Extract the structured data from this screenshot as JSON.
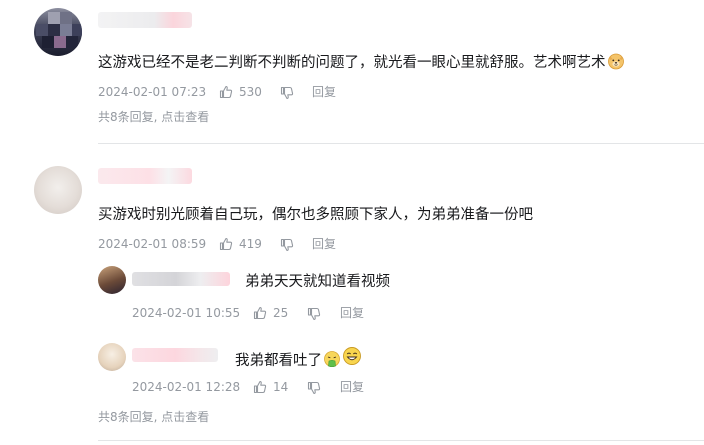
{
  "comments": [
    {
      "text": "这游戏已经不是老二判断不判断的问题了，就光看一眼心里就舒服。艺术啊艺术",
      "emoji": "doge-emoji",
      "date": "2024-02-01 07:23",
      "likes": "530",
      "reply_label": "回复",
      "more_replies": "共8条回复, 点击查看"
    },
    {
      "text": "买游戏时别光顾着自己玩，偶尔也多照顾下家人，为弟弟准备一份吧",
      "date": "2024-02-01 08:59",
      "likes": "419",
      "reply_label": "回复",
      "more_replies": "共8条回复, 点击查看",
      "replies": [
        {
          "text": "弟弟天天就知道看视频",
          "date": "2024-02-01 10:55",
          "likes": "25",
          "reply_label": "回复"
        },
        {
          "text": "我弟都看吐了",
          "emojis": [
            "vomit-emoji",
            "grin-emoji"
          ],
          "date": "2024-02-01 12:28",
          "likes": "14",
          "reply_label": "回复"
        }
      ]
    }
  ],
  "colors": {
    "text": "#18191c",
    "meta": "#9499a0",
    "divider": "#e3e5e7"
  }
}
